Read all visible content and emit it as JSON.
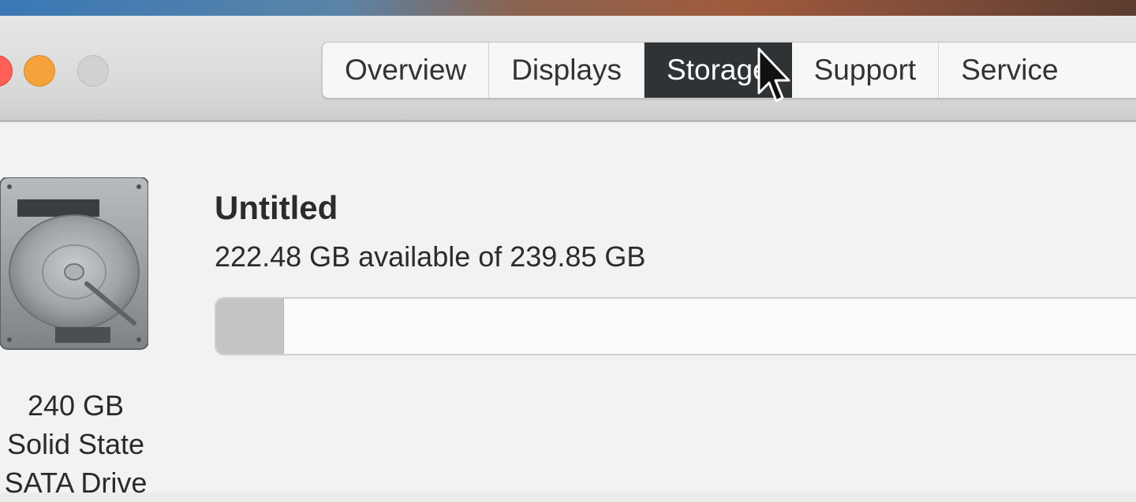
{
  "tabs": [
    {
      "label": "Overview",
      "active": false
    },
    {
      "label": "Displays",
      "active": false
    },
    {
      "label": "Storage",
      "active": true
    },
    {
      "label": "Support",
      "active": false
    },
    {
      "label": "Service",
      "active": false
    }
  ],
  "storage": {
    "volume_name": "Untitled",
    "availability_text": "222.48 GB available of 239.85 GB",
    "used_fraction": 0.072
  },
  "drive": {
    "icon": "hard-drive-icon",
    "caption_lines": [
      "240 GB",
      "Solid State",
      "SATA Drive"
    ]
  },
  "colors": {
    "active_tab": "#2f3336",
    "close_button": "#ff5f57",
    "minimize_button": "#f5a23a",
    "zoom_button_inactive": "#d1d1d1",
    "used_segment": "#c4c4c4"
  }
}
